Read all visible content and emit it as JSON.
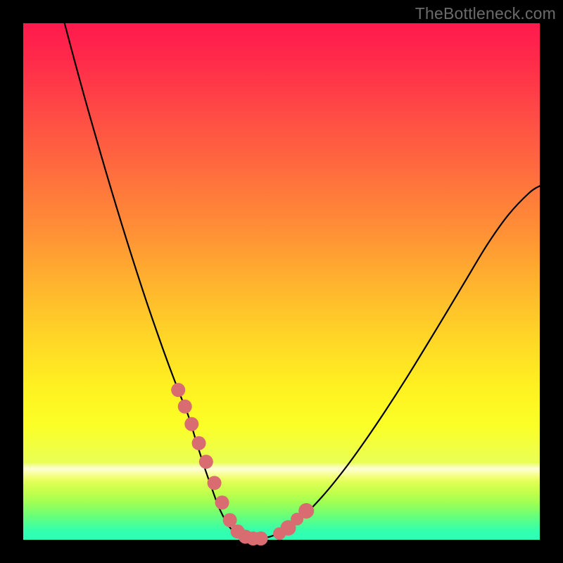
{
  "watermark": "TheBottleneck.com",
  "colors": {
    "frame": "#000000",
    "curve": "#000000",
    "marker": "#d96c71"
  },
  "chart_data": {
    "type": "line",
    "title": "",
    "xlabel": "",
    "ylabel": "",
    "xlim": [
      0,
      100
    ],
    "ylim": [
      0,
      100
    ],
    "grid": false,
    "series": [
      {
        "name": "curve",
        "x": [
          8,
          10,
          12,
          14,
          16,
          18,
          20,
          22,
          24,
          26,
          28,
          30,
          32,
          33.5,
          35,
          36.5,
          38,
          40,
          42,
          44,
          47,
          50,
          54,
          58,
          62,
          66,
          70,
          74,
          78,
          82,
          86,
          90,
          94,
          98,
          100
        ],
        "y": [
          100,
          92.5,
          85.2,
          78.2,
          71.3,
          64.6,
          58.1,
          51.8,
          45.7,
          39.9,
          34.3,
          29.0,
          23.9,
          19.0,
          14.3,
          10.0,
          6.0,
          2.4,
          0.7,
          0.2,
          0.4,
          1.6,
          4.4,
          8.5,
          13.4,
          18.9,
          24.8,
          31.0,
          37.5,
          44.1,
          50.8,
          57.4,
          63.0,
          67.2,
          68.5
        ]
      }
    ],
    "markers": {
      "name": "highlight-dots",
      "x": [
        30.0,
        31.3,
        32.6,
        34.0,
        35.4,
        37.0,
        38.5,
        40.0,
        41.5,
        43.0,
        44.5,
        46.0,
        49.6,
        51.3,
        53.0,
        54.8
      ],
      "y": [
        29.0,
        25.8,
        22.4,
        18.7,
        15.1,
        11.0,
        7.2,
        3.8,
        1.6,
        0.6,
        0.25,
        0.25,
        1.2,
        2.3,
        4.0,
        5.6
      ],
      "r": [
        10,
        10,
        10,
        10,
        10,
        10,
        10,
        10,
        10,
        10,
        10,
        10,
        9,
        11,
        9,
        11
      ]
    }
  }
}
